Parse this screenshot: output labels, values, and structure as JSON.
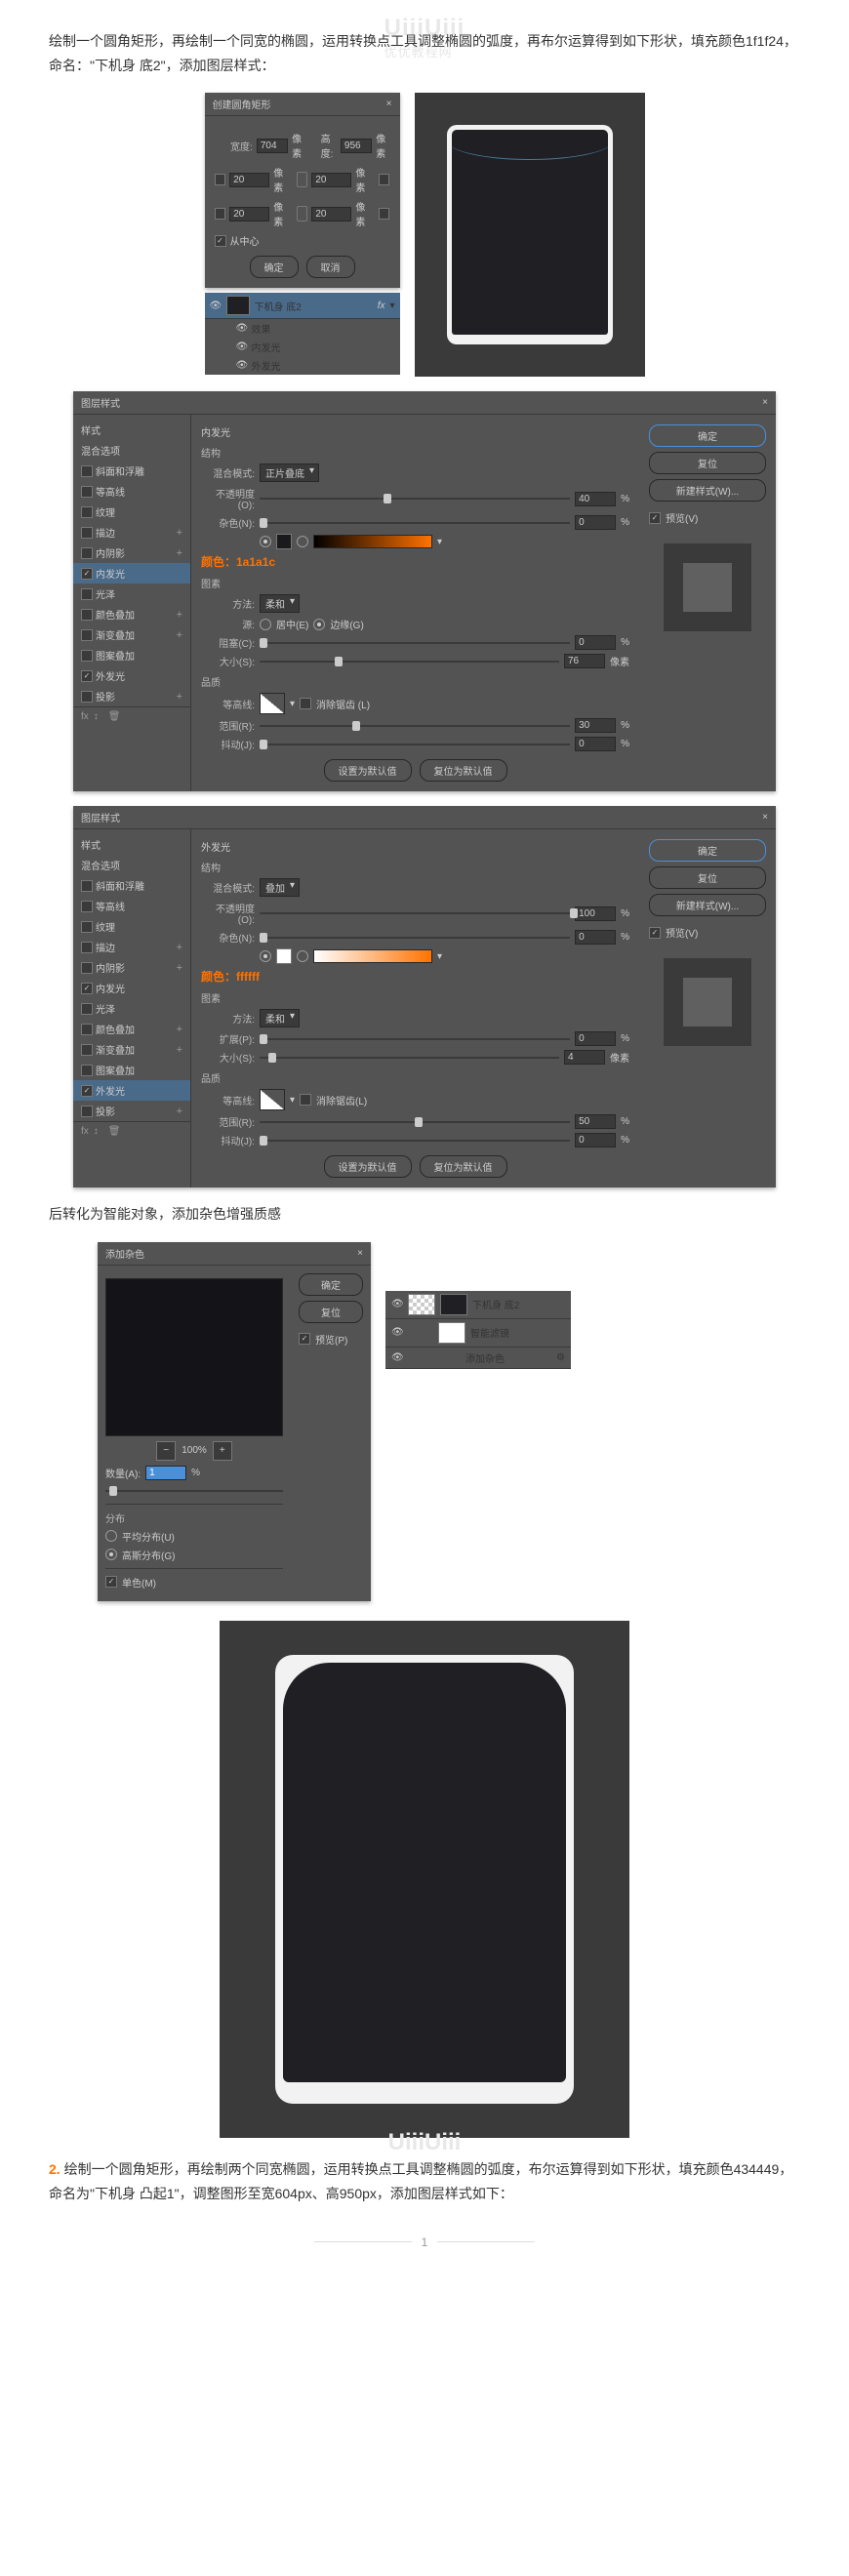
{
  "watermark": "UiiiUiii",
  "watermark_sub": "优优教程网",
  "para1": "绘制一个圆角矩形，再绘制一个同宽的椭圆，运用转换点工具调整椭圆的弧度，再布尔运算得到如下形状，填充颜色1f1f24，命名：\"下机身 底2\"，添加图层样式：",
  "rect_dialog": {
    "title": "创建圆角矩形",
    "width_label": "宽度:",
    "width": "704",
    "height_label": "高度:",
    "height": "956",
    "unit": "像素",
    "r_tl": "20",
    "r_tr": "20",
    "r_bl": "20",
    "r_br": "20",
    "from_center": "从中心",
    "ok": "确定",
    "cancel": "取消"
  },
  "layer": {
    "name": "下机身  底2",
    "fx": "fx",
    "effects": "效果",
    "inner": "内发光",
    "outer": "外发光"
  },
  "style_dialog": {
    "title": "图层样式",
    "ok": "确定",
    "cancel": "复位",
    "new_style": "新建样式(W)...",
    "preview": "预览(V)",
    "left_header": "样式",
    "blend_opts": "混合选项",
    "items": [
      "斜面和浮雕",
      "等高线",
      "纹理",
      "描边",
      "内阴影",
      "内发光",
      "光泽",
      "颜色叠加",
      "渐变叠加",
      "图案叠加",
      "外发光",
      "投影"
    ],
    "selected1": "内发光",
    "selected2": "外发光",
    "default_btn": "设置为默认值",
    "reset_btn": "复位为默认值"
  },
  "inner_glow": {
    "section": "内发光",
    "struct": "结构",
    "blend_mode_label": "混合模式:",
    "blend_mode": "正片叠底",
    "opacity_label": "不透明度(O):",
    "opacity": "40",
    "noise_label": "杂色(N):",
    "noise": "0",
    "pct": "%",
    "color_annot": "颜色：1a1a1c",
    "elements": "图素",
    "method_label": "方法:",
    "method": "柔和",
    "source_label": "源:",
    "source_center": "居中(E)",
    "source_edge": "边缘(G)",
    "choke_label": "阻塞(C):",
    "choke": "0",
    "size_label": "大小(S):",
    "size": "76",
    "px": "像素",
    "quality": "品质",
    "contour_label": "等高线:",
    "anti_alias": "消除锯齿 (L)",
    "range_label": "范围(R):",
    "range": "30",
    "jitter_label": "抖动(J):",
    "jitter": "0"
  },
  "outer_glow": {
    "section": "外发光",
    "struct": "结构",
    "blend_mode_label": "混合模式:",
    "blend_mode": "叠加",
    "opacity_label": "不透明度(O):",
    "opacity": "100",
    "noise_label": "杂色(N):",
    "noise": "0",
    "pct": "%",
    "color_annot": "颜色：ffffff",
    "elements": "图素",
    "method_label": "方法:",
    "method": "柔和",
    "spread_label": "扩展(P):",
    "spread": "0",
    "size_label": "大小(S):",
    "size": "4",
    "px": "像素",
    "quality": "品质",
    "contour_label": "等高线:",
    "anti_alias": "消除锯齿(L)",
    "range_label": "范围(R):",
    "range": "50",
    "jitter_label": "抖动(J):",
    "jitter": "0"
  },
  "para2": "后转化为智能对象，添加杂色增强质感",
  "noise": {
    "title": "添加杂色",
    "ok": "确定",
    "cancel": "复位",
    "preview": "预览(P)",
    "zoom": "100%",
    "amount_label": "数量(A):",
    "amount": "1",
    "pct": "%",
    "dist": "分布",
    "uniform": "平均分布(U)",
    "gaussian": "高斯分布(G)",
    "mono": "单色(M)"
  },
  "smart": {
    "name": "下机身  底2",
    "filters": "智能滤镜",
    "add_noise": "添加杂色"
  },
  "step2_num": "2.",
  "para3": " 绘制一个圆角矩形，再绘制两个同宽椭圆，运用转换点工具调整椭圆的弧度，布尔运算得到如下形状，填充颜色434449，命名为\"下机身 凸起1\"，调整图形至宽604px、高950px，添加图层样式如下：",
  "page_num": "1"
}
